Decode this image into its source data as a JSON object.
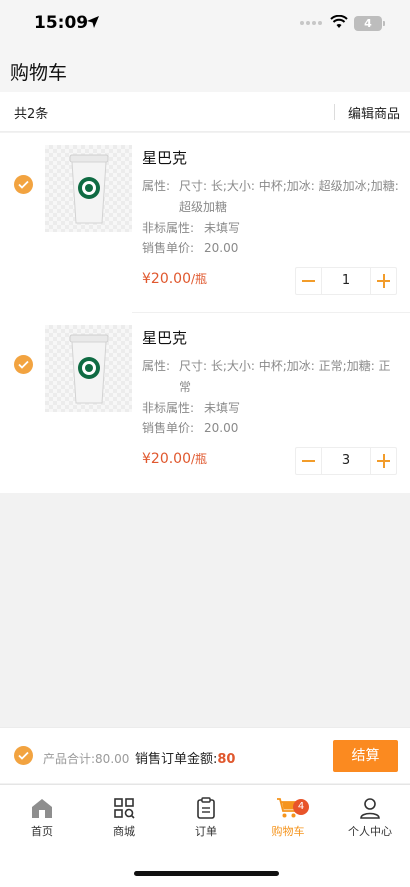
{
  "status_bar": {
    "time": "15:09",
    "battery": "4"
  },
  "header": {
    "title": "购物车"
  },
  "summary": {
    "count_text": "共2条",
    "edit_label": "编辑商品"
  },
  "items": [
    {
      "name": "星巴克",
      "attr_label": "属性:",
      "attr_value": "尺寸: 长;大小: 中杯;加冰: 超级加冰;加糖: 超级加糖",
      "nonstd_label": "非标属性:",
      "nonstd_value": "未填写",
      "unit_price_label": "销售单价:",
      "unit_price_value": "20.00",
      "price": "¥20.00",
      "price_unit": "/瓶",
      "quantity": "1",
      "checked": true
    },
    {
      "name": "星巴克",
      "attr_label": "属性:",
      "attr_value": "尺寸: 长;大小: 中杯;加冰: 正常;加糖: 正常",
      "nonstd_label": "非标属性:",
      "nonstd_value": "未填写",
      "unit_price_label": "销售单价:",
      "unit_price_value": "20.00",
      "price": "¥20.00",
      "price_unit": "/瓶",
      "quantity": "3",
      "checked": true
    }
  ],
  "checkout": {
    "total_text": "产品合计:80.00",
    "order_label": "销售订单金额:",
    "order_amount": "80",
    "button_label": "结算"
  },
  "tabs": [
    {
      "label": "首页",
      "icon": "home-icon"
    },
    {
      "label": "商城",
      "icon": "grid-search-icon"
    },
    {
      "label": "订单",
      "icon": "clipboard-icon"
    },
    {
      "label": "购物车",
      "icon": "cart-icon",
      "badge": "4",
      "active": true
    },
    {
      "label": "个人中心",
      "icon": "user-icon"
    }
  ],
  "colors": {
    "accent": "#f5941d",
    "price": "#e0582e",
    "checkbox": "#f2a340"
  }
}
